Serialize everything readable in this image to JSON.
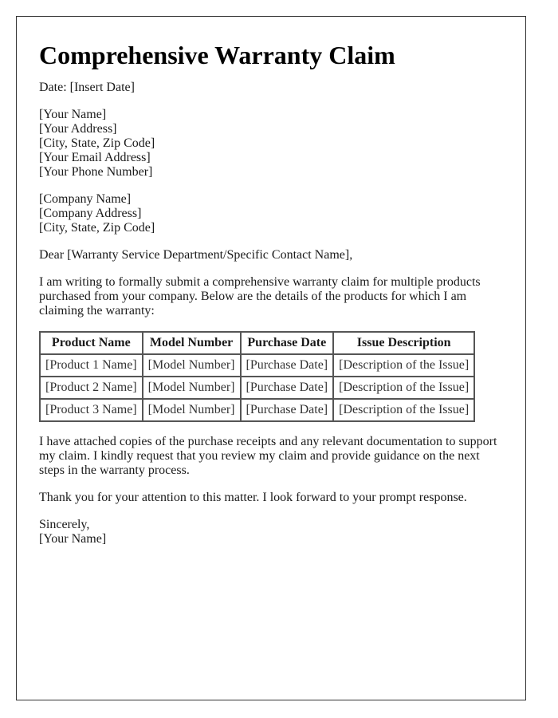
{
  "title": "Comprehensive Warranty Claim",
  "date_line": "Date: [Insert Date]",
  "sender": [
    "[Your Name]",
    "[Your Address]",
    "[City, State, Zip Code]",
    "[Your Email Address]",
    "[Your Phone Number]"
  ],
  "recipient": [
    "[Company Name]",
    "[Company Address]",
    "[City, State, Zip Code]"
  ],
  "salutation": "Dear [Warranty Service Department/Specific Contact Name],",
  "intro_paragraph": "I am writing to formally submit a comprehensive warranty claim for multiple products purchased from your company. Below are the details of the products for which I am claiming the warranty:",
  "table": {
    "headers": [
      "Product Name",
      "Model Number",
      "Purchase Date",
      "Issue Description"
    ],
    "rows": [
      [
        "[Product 1 Name]",
        "[Model Number]",
        "[Purchase Date]",
        "[Description of the Issue]"
      ],
      [
        "[Product 2 Name]",
        "[Model Number]",
        "[Purchase Date]",
        "[Description of the Issue]"
      ],
      [
        "[Product 3 Name]",
        "[Model Number]",
        "[Purchase Date]",
        "[Description of the Issue]"
      ]
    ]
  },
  "attachment_paragraph": "I have attached copies of the purchase receipts and any relevant documentation to support my claim. I kindly request that you review my claim and provide guidance on the next steps in the warranty process.",
  "thanks_paragraph": "Thank you for your attention to this matter. I look forward to your prompt response.",
  "closing": "Sincerely,",
  "signature": "[Your Name]"
}
